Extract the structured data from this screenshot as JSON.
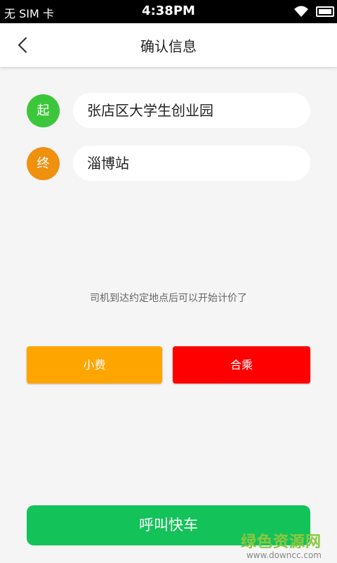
{
  "status_bar": {
    "carrier": "无 SIM 卡",
    "time": "4:38PM"
  },
  "header": {
    "title": "确认信息",
    "back_icon": "chevron-left-icon"
  },
  "route": {
    "start": {
      "badge": "起",
      "address": "张店区大学生创业园",
      "badge_color": "#3cc63c"
    },
    "end": {
      "badge": "终",
      "address": "淄博站",
      "badge_color": "#f0900f"
    }
  },
  "hint": "司机到达约定地点后可以开始计价了",
  "options": {
    "tip_label": "小费",
    "tip_color": "#ffa500",
    "carpool_label": "合乘",
    "carpool_color": "#ff0000"
  },
  "call_button": {
    "label": "呼叫快车",
    "color": "#14c25a"
  },
  "watermark": {
    "text": "绿色资源网",
    "url": "www.downcc.com"
  }
}
